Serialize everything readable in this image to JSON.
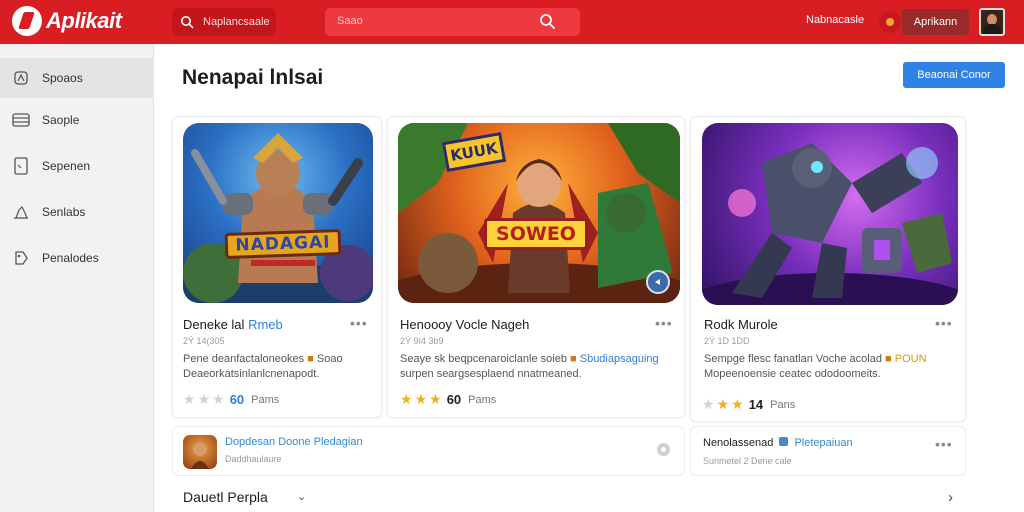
{
  "header": {
    "app_name": "Aplikait",
    "search_left_placeholder": "Naplancsaale",
    "search_main_placeholder": "Saao",
    "nav_label": "Nabnacasle",
    "account_label": "Aprikann"
  },
  "sidebar": {
    "items": [
      {
        "label": "Spoaos",
        "icon": "home-icon"
      },
      {
        "label": "Saople",
        "icon": "list-icon"
      },
      {
        "label": "Sepenen",
        "icon": "page-icon"
      },
      {
        "label": "Senlabs",
        "icon": "chart-icon"
      },
      {
        "label": "Penalodes",
        "icon": "tag-icon"
      }
    ]
  },
  "main": {
    "title": "Nenapai lnlsai",
    "primary_button": "Beaonai Conor"
  },
  "cards": [
    {
      "title": "Deneke lal",
      "title_accent": "Rmeb",
      "meta": "2Ý 14(305",
      "desc_line1": "Pene deanfactaloneokes",
      "desc_accent": "Soao",
      "desc_line2": "Deaeorkatsinlanlcnenapodt.",
      "rating_count": "60",
      "rating_unit": "Pams",
      "stars_filled": 0,
      "accent_color": "#2f7fd8"
    },
    {
      "title": "Henoooy Vocle Nageh",
      "title_accent": "",
      "meta": "2Ý 9ì4 3b9",
      "desc_line1": "Seaye sk beqpcenaroiclanle soieb",
      "desc_accent": "Sbudiapsaguing",
      "desc_line2": "surpen seargsesplaend nnatmeaned.",
      "rating_count": "60",
      "rating_unit": "Pams",
      "stars_filled": 3,
      "accent_color": "#2f7fd8"
    },
    {
      "title": "Rodk Murole",
      "title_accent": "",
      "meta": "2Ý 1D 1DD",
      "desc_line1": "Sempge flesc fanatlan Voche acolad",
      "desc_accent": "POUN",
      "desc_line2": "Mopeenoensie ceatec ododoomeits.",
      "rating_count": "14",
      "rating_unit": "Pans",
      "stars_filled": 3,
      "accent_color": "#d39a12"
    }
  ],
  "bottom_cards": [
    {
      "title": "Dopdesan Doone Pledagian",
      "sub": "Daddhaulaure"
    },
    {
      "title": "Nenolassenad",
      "title_accent": "Pletepaiuan",
      "sub": "Sunmetel 2 Dene cale"
    }
  ],
  "footer": {
    "section_title": "Dauetl Perpla"
  },
  "art_titles": [
    "NADAGAI",
    "SOWEO",
    "KUUK"
  ]
}
